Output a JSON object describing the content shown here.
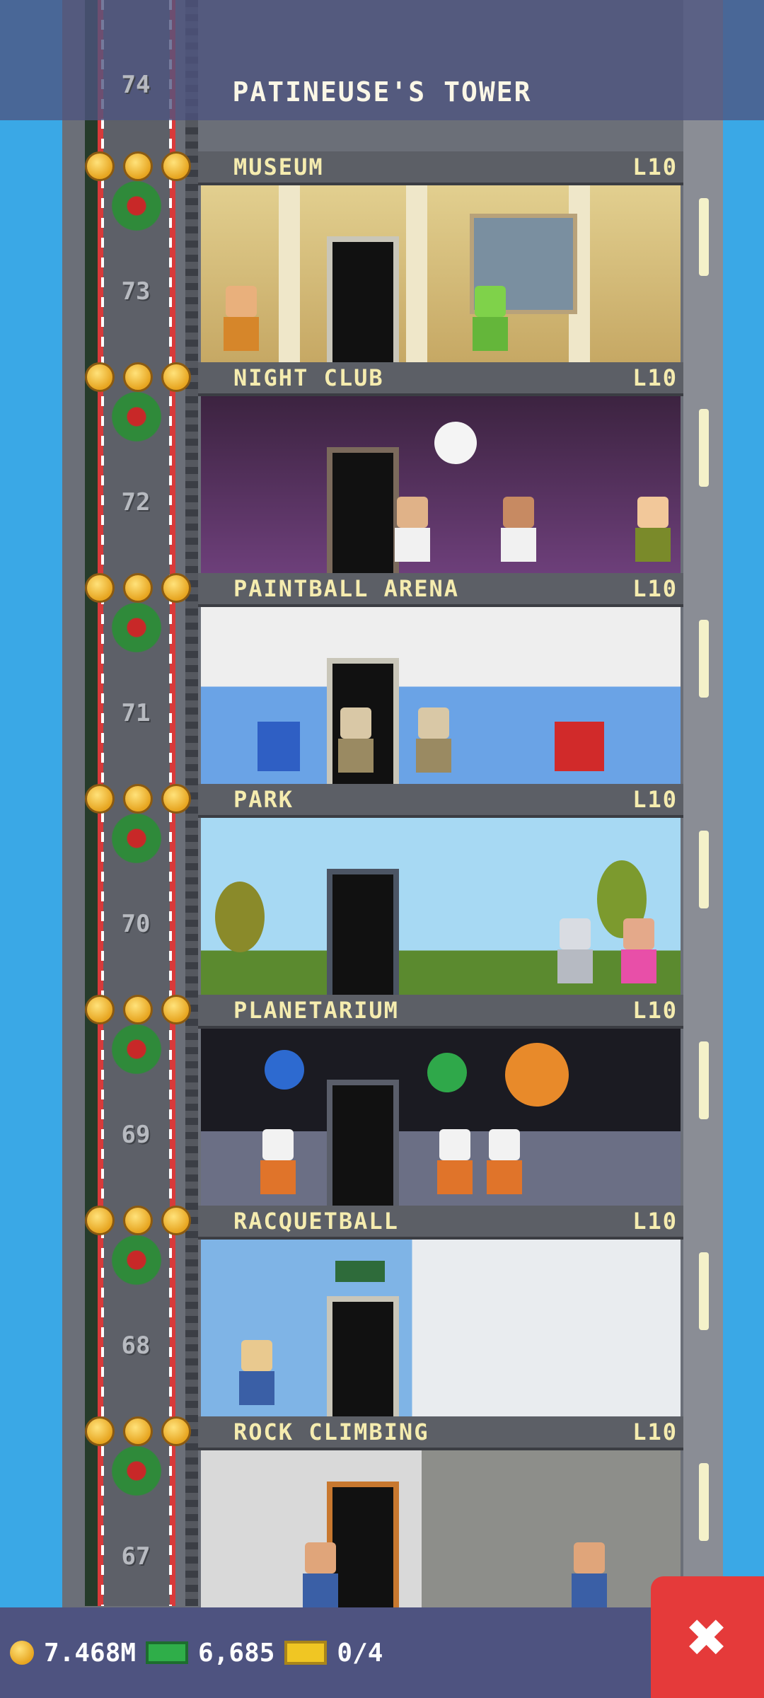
{
  "header": {
    "title": "PATINEUSE'S TOWER"
  },
  "floors": [
    {
      "name": "MUSEUM",
      "level": "L10",
      "number": "73"
    },
    {
      "name": "NIGHT CLUB",
      "level": "L10",
      "number": "72"
    },
    {
      "name": "PAINTBALL ARENA",
      "level": "L10",
      "number": "71"
    },
    {
      "name": "PARK",
      "level": "L10",
      "number": "70"
    },
    {
      "name": "PLANETARIUM",
      "level": "L10",
      "number": "69"
    },
    {
      "name": "RACQUETBALL",
      "level": "L10",
      "number": "68"
    },
    {
      "name": "ROCK CLIMBING",
      "level": "L10",
      "number": "67"
    }
  ],
  "top_floor_number": "74",
  "footer": {
    "coins": "7.468M",
    "bux": "6,685",
    "tickets": "0/4"
  },
  "colors": {
    "sky": "#3aa8e6",
    "header_bar": "#4e5380",
    "floor_label": "#f5ecaf",
    "close_button": "#e53a3a"
  },
  "icons": {
    "coin": "coin-icon",
    "bux": "bux-icon",
    "ticket": "ticket-icon",
    "close": "close-icon"
  },
  "close_glyph": "✖"
}
